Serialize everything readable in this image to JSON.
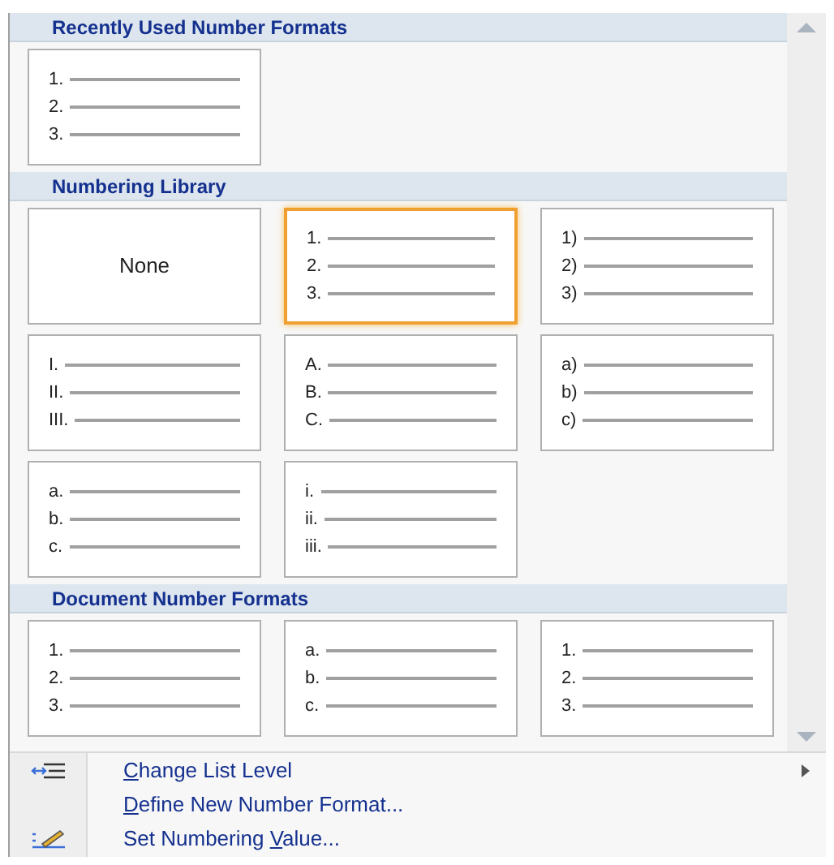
{
  "sections": [
    {
      "title": "Recently Used Number Formats",
      "tiles": [
        {
          "kind": "list",
          "selected": false,
          "labels": [
            "1.",
            "2.",
            "3."
          ]
        }
      ]
    },
    {
      "title": "Numbering Library",
      "tiles": [
        {
          "kind": "none",
          "selected": false,
          "text": "None"
        },
        {
          "kind": "list",
          "selected": true,
          "labels": [
            "1.",
            "2.",
            "3."
          ]
        },
        {
          "kind": "list",
          "selected": false,
          "labels": [
            "1)",
            "2)",
            "3)"
          ]
        },
        {
          "kind": "list",
          "selected": false,
          "labels": [
            "I.",
            "II.",
            "III."
          ]
        },
        {
          "kind": "list",
          "selected": false,
          "labels": [
            "A.",
            "B.",
            "C."
          ]
        },
        {
          "kind": "list",
          "selected": false,
          "labels": [
            "a)",
            "b)",
            "c)"
          ]
        },
        {
          "kind": "list",
          "selected": false,
          "labels": [
            "a.",
            "b.",
            "c."
          ]
        },
        {
          "kind": "list",
          "selected": false,
          "labels": [
            "i.",
            "ii.",
            "iii."
          ]
        }
      ]
    },
    {
      "title": "Document Number Formats",
      "tiles": [
        {
          "kind": "list",
          "selected": false,
          "labels": [
            "1.",
            "2.",
            "3."
          ]
        },
        {
          "kind": "list",
          "selected": false,
          "labels": [
            "a.",
            "b.",
            "c."
          ]
        },
        {
          "kind": "list",
          "selected": false,
          "labels": [
            "1.",
            "2.",
            "3."
          ]
        }
      ]
    }
  ],
  "menu": [
    {
      "key": "C",
      "after": "hange List Level",
      "submenu": true
    },
    {
      "key": "D",
      "after": "efine New Number Format...",
      "submenu": false
    },
    {
      "before": "Set Numbering ",
      "key": "V",
      "after": "alue...",
      "submenu": false
    }
  ]
}
